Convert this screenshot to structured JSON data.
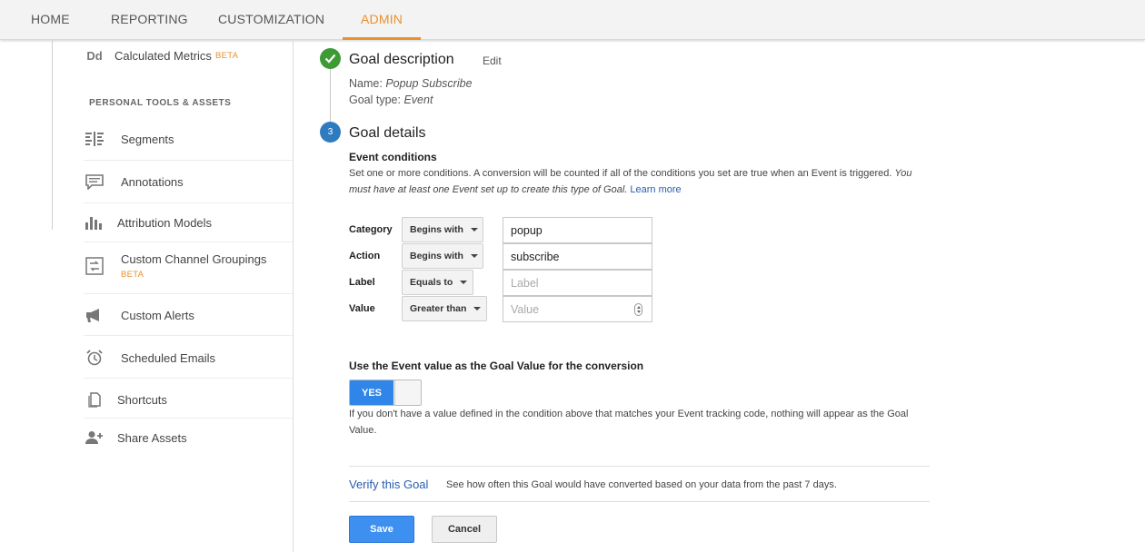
{
  "nav": {
    "tabs": [
      {
        "label": "HOME"
      },
      {
        "label": "REPORTING"
      },
      {
        "label": "CUSTOMIZATION"
      },
      {
        "label": "ADMIN",
        "active": true
      }
    ]
  },
  "sidebar": {
    "calculated_metrics": {
      "icon_text": "Dd",
      "label": "Calculated Metrics",
      "badge": "BETA"
    },
    "section_heading": "PERSONAL TOOLS & ASSETS",
    "items": [
      {
        "label": "Segments",
        "icon": "segments-icon"
      },
      {
        "label": "Annotations",
        "icon": "comment-icon"
      },
      {
        "label": "Attribution Models",
        "icon": "bar-chart-icon"
      },
      {
        "label": "Custom Channel Groupings",
        "badge": "BETA",
        "icon": "channel-groupings-icon"
      },
      {
        "label": "Custom Alerts",
        "icon": "megaphone-icon"
      },
      {
        "label": "Scheduled Emails",
        "icon": "alarm-clock-icon"
      },
      {
        "label": "Shortcuts",
        "icon": "document-icon"
      },
      {
        "label": "Share Assets",
        "icon": "add-user-icon"
      }
    ]
  },
  "goal_description": {
    "title": "Goal description",
    "edit_label": "Edit",
    "name_prefix": "Name:",
    "name_value": "Popup Subscribe",
    "type_prefix": "Goal type:",
    "type_value": "Event"
  },
  "goal_details": {
    "step_number": "3",
    "title": "Goal details",
    "event_conditions_heading": "Event conditions",
    "description_plain": "Set one or more conditions. A conversion will be counted if all of the conditions you set are true when an Event is triggered.",
    "description_italic_1": "You",
    "description_italic_2": "must have at least one Event set up to create this type of Goal.",
    "learn_more": "Learn more",
    "conditions": [
      {
        "label": "Category",
        "operator": "Begins with",
        "value": "popup",
        "placeholder": ""
      },
      {
        "label": "Action",
        "operator": "Begins with",
        "value": "subscribe",
        "placeholder": ""
      },
      {
        "label": "Label",
        "operator": "Equals to",
        "value": "",
        "placeholder": "Label"
      },
      {
        "label": "Value",
        "operator": "Greater than",
        "value": "",
        "placeholder": "Value"
      }
    ],
    "use_value_heading": "Use the Event value as the Goal Value for the conversion",
    "toggle_label": "YES",
    "toggle_on": true,
    "use_value_note_1": "If you don't have a value defined in the condition above that matches your Event tracking code, nothing will appear as the Goal",
    "use_value_note_2": "Value."
  },
  "verify": {
    "link": "Verify this Goal",
    "description": "See how often this Goal would have converted based on your data from the past 7 days."
  },
  "actions": {
    "save": "Save",
    "cancel": "Cancel"
  },
  "colors": {
    "accent": "#e8912d",
    "primary_button": "#3d8ff0",
    "step_done": "#3d9b35",
    "step_current": "#2f7bbf",
    "link": "#2a5db0"
  }
}
